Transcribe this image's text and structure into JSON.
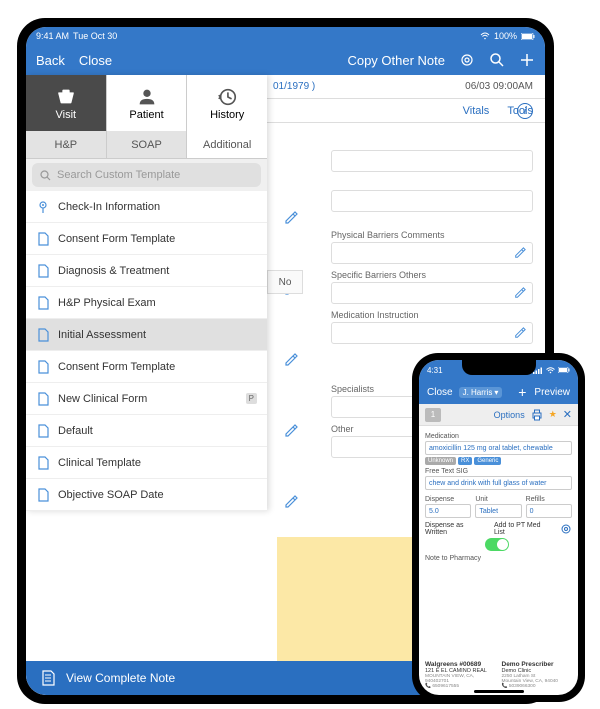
{
  "ipad": {
    "status": {
      "time": "9:41 AM",
      "date": "Tue Oct 30",
      "battery": "100%"
    },
    "nav": {
      "back": "Back",
      "close": "Close",
      "copy": "Copy Other Note"
    },
    "meta": {
      "patient_frag": "01/1979 )",
      "datetime": "06/03 09:00AM",
      "vitals": "Vitals",
      "tools": "Tools"
    },
    "panel": {
      "tabs1": [
        "Visit",
        "Patient",
        "History"
      ],
      "tabs2": [
        "H&P",
        "SOAP",
        "Additional"
      ],
      "search_placeholder": "Search Custom Template",
      "templates": [
        {
          "label": "Check-In Information",
          "icon": "pin"
        },
        {
          "label": "Consent Form Template",
          "icon": "doc"
        },
        {
          "label": "Diagnosis & Treatment",
          "icon": "doc"
        },
        {
          "label": "H&P Physical Exam",
          "icon": "doc"
        },
        {
          "label": "Initial Assessment",
          "icon": "doc",
          "selected": true
        },
        {
          "label": "Consent Form Template",
          "icon": "doc"
        },
        {
          "label": "New Clinical Form",
          "icon": "doc",
          "badge": "P"
        },
        {
          "label": "Default",
          "icon": "doc"
        },
        {
          "label": "Clinical Template",
          "icon": "doc"
        },
        {
          "label": "Objective SOAP Date",
          "icon": "doc"
        }
      ]
    },
    "form": {
      "no_label": "No",
      "fields": [
        "Physical Barriers Comments",
        "Specific Barriers Others",
        "Medication Instruction",
        "Specialists",
        "Other"
      ]
    },
    "bottom": "View Complete Note"
  },
  "iphone": {
    "status": {
      "time": "4:31"
    },
    "nav": {
      "close": "Close",
      "patient": "J. Harris",
      "plus": "+",
      "preview": "Preview"
    },
    "toolbar": {
      "num": "1",
      "options": "Options"
    },
    "med": {
      "label": "Medication",
      "value": "amoxicillin 125 mg oral tablet, chewable",
      "tags": [
        "Unknown",
        "RX",
        "Generic"
      ],
      "sig_label": "Free Text SIG",
      "sig_value": "chew and drink with full glass of water",
      "dispense_label": "Dispense",
      "dispense_value": "5.0",
      "unit_label": "Unit",
      "unit_value": "Tablet",
      "refills_label": "Refills",
      "refills_value": "0",
      "written": "Dispense as Written",
      "add_pt": "Add to PT Med List",
      "note_label": "Note to Pharmacy"
    },
    "pharmacy": {
      "name": "Walgreens #00689",
      "addr1": "121 E EL CAMINO REAL",
      "addr2": "MOUNTAIN VIEW, CA, 940402701",
      "phone": "6509617555"
    },
    "prescriber": {
      "name": "Demo Prescriber",
      "clinic": "Demo Clinic",
      "addr": "2250 Latham St\nMountain View, CA, 94040",
      "phone": "5039066300"
    }
  }
}
